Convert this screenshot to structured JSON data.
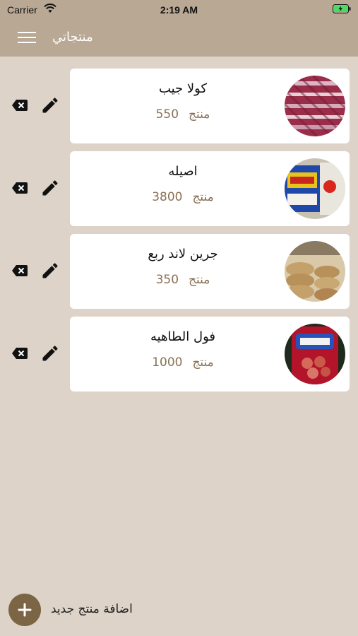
{
  "status_bar": {
    "carrier": "Carrier",
    "time": "2:19 AM"
  },
  "nav": {
    "title": "منتجاتي",
    "menu_icon": "hamburger-menu-icon"
  },
  "products": [
    {
      "name": "كولا جيب",
      "quantity": "550",
      "unit": "منتج"
    },
    {
      "name": "اصيله",
      "quantity": "3800",
      "unit": "منتج"
    },
    {
      "name": "جرين لاند ربع",
      "quantity": "350",
      "unit": "منتج"
    },
    {
      "name": "فول الطاهيه",
      "quantity": "1000",
      "unit": "منتج"
    }
  ],
  "add_button": {
    "label": "اضافة منتج جديد"
  },
  "colors": {
    "header": "#b9a893",
    "background": "#ddd3c8",
    "accent": "#7b6545",
    "quantity_text": "#8a7155"
  }
}
